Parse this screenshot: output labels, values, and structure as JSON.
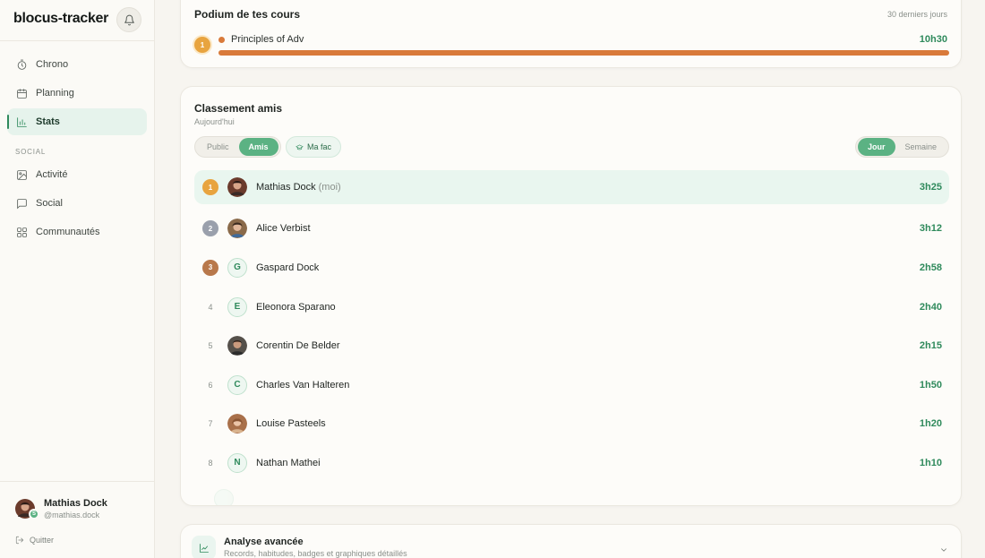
{
  "sidebar": {
    "brand": "blocus-tracker",
    "nav": [
      {
        "label": "Chrono",
        "icon": "timer-icon"
      },
      {
        "label": "Planning",
        "icon": "calendar-icon"
      },
      {
        "label": "Stats",
        "icon": "bar-chart-icon",
        "active": true
      }
    ],
    "social_section_label": "SOCIAL",
    "social_nav": [
      {
        "label": "Activité",
        "icon": "image-icon"
      },
      {
        "label": "Social",
        "icon": "message-icon"
      },
      {
        "label": "Communautés",
        "icon": "grid-icon"
      }
    ],
    "profile": {
      "name": "Mathias Dock",
      "handle": "@mathias.dock",
      "badge": "S"
    },
    "quit_label": "Quitter"
  },
  "podium": {
    "title": "Podium de tes cours",
    "range": "30 derniers jours",
    "course": {
      "rank": "1",
      "name": "Principles of Adv",
      "time": "10h30",
      "progress": 1.0
    }
  },
  "ranking": {
    "title": "Classement amis",
    "subtitle": "Aujourd'hui",
    "scope_tabs": [
      {
        "label": "Public",
        "active": false
      },
      {
        "label": "Amis",
        "active": true
      }
    ],
    "fac_filter": "Ma fac",
    "period_tabs": [
      {
        "label": "Jour",
        "active": true
      },
      {
        "label": "Semaine",
        "active": false
      }
    ],
    "rows": [
      {
        "rank": "1",
        "name": "Mathias Dock",
        "suffix": "(moi)",
        "time": "3h25",
        "avatar": "photo",
        "medal": "gold"
      },
      {
        "rank": "2",
        "name": "Alice Verbist",
        "time": "3h12",
        "avatar": "photo",
        "medal": "silver"
      },
      {
        "rank": "3",
        "name": "Gaspard Dock",
        "time": "2h58",
        "avatar": "G",
        "medal": "bronze"
      },
      {
        "rank": "4",
        "name": "Eleonora Sparano",
        "time": "2h40",
        "avatar": "E"
      },
      {
        "rank": "5",
        "name": "Corentin De Belder",
        "time": "2h15",
        "avatar": "photo"
      },
      {
        "rank": "6",
        "name": "Charles Van Halteren",
        "time": "1h50",
        "avatar": "C"
      },
      {
        "rank": "7",
        "name": "Louise Pasteels",
        "time": "1h20",
        "avatar": "photo"
      },
      {
        "rank": "8",
        "name": "Nathan Mathei",
        "time": "1h10",
        "avatar": "N"
      }
    ]
  },
  "analysis": {
    "title": "Analyse avancée",
    "subtitle": "Records, habitudes, badges et graphiques détaillés"
  },
  "colors": {
    "accent": "#2f8a5c",
    "accent_light": "#5bb283",
    "course_bar": "#d97a3a",
    "gold": "#e8a43f",
    "silver": "#9aa0ac",
    "bronze": "#b8784b"
  }
}
